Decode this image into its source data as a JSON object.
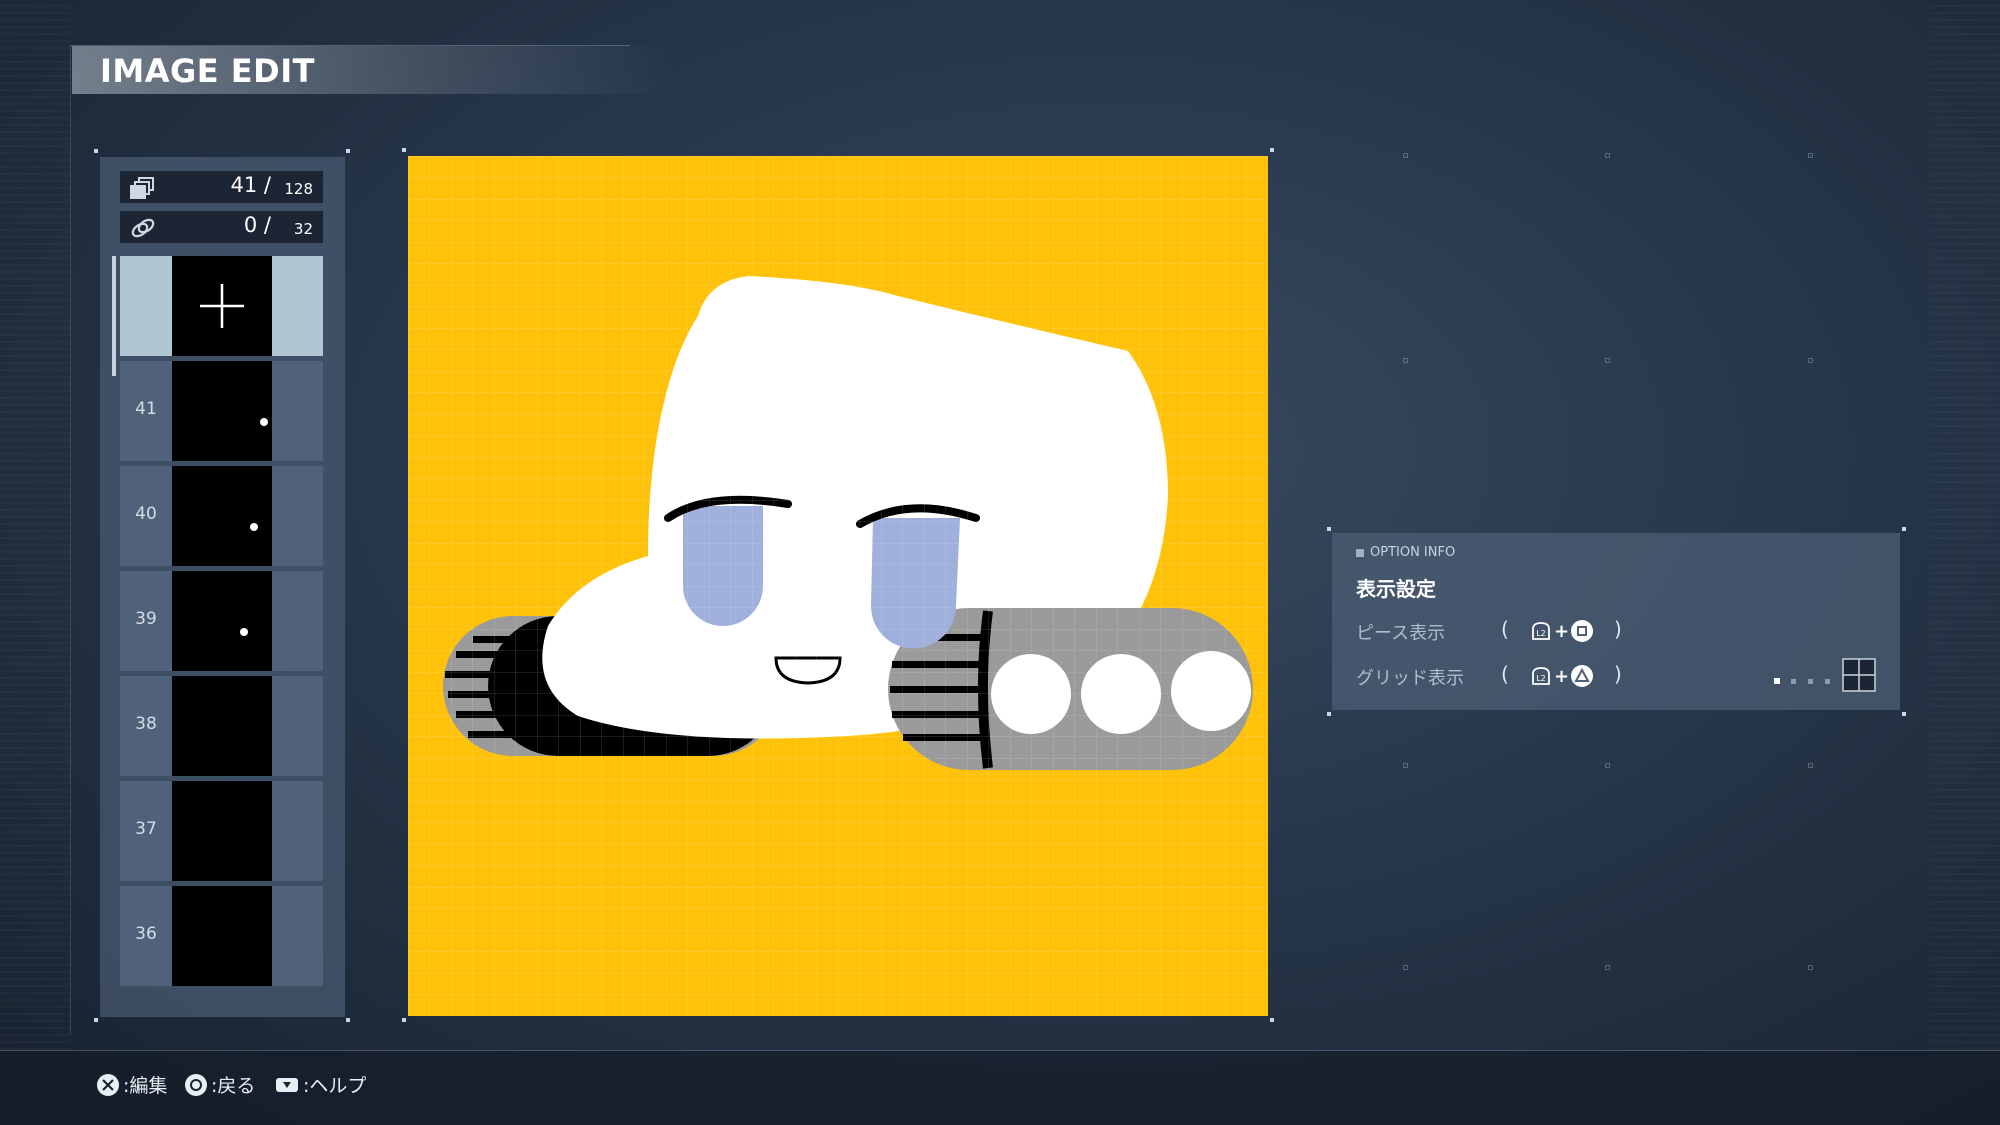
{
  "header": {
    "title": "IMAGE EDIT"
  },
  "pieces": {
    "count_current": "41 /",
    "count_max": "128",
    "link_current": "0 /",
    "link_max": "32",
    "rows": [
      {
        "num": "41"
      },
      {
        "num": "40"
      },
      {
        "num": "39"
      },
      {
        "num": "38"
      },
      {
        "num": "37"
      },
      {
        "num": "36"
      }
    ]
  },
  "canvas": {
    "background_color": "#ffc20a"
  },
  "option_info": {
    "header": "OPTION INFO",
    "section": "表示設定",
    "piece_display_label": "ピース表示",
    "grid_display_label": "グリッド表示",
    "open_paren": "(",
    "close_paren": ")",
    "plus": "+"
  },
  "footer": {
    "edit_hint": ":編集",
    "back_hint": ":戻る",
    "help_hint": ":ヘルプ"
  }
}
